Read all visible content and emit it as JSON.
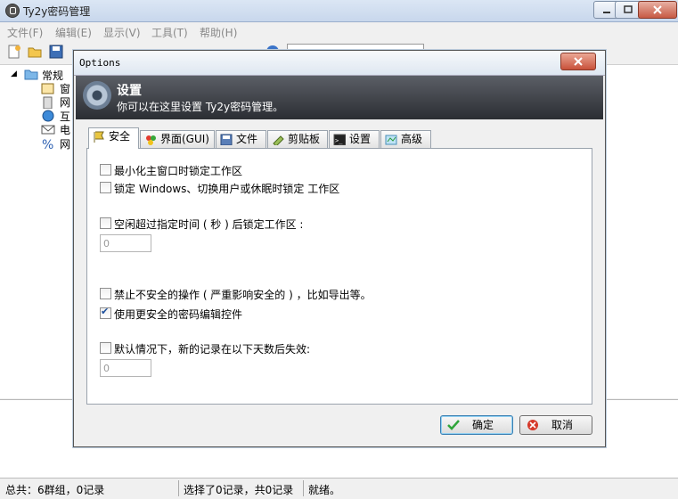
{
  "window": {
    "title": "Ty2y密码管理",
    "min": "0",
    "max": "1",
    "close": "r"
  },
  "menu": [
    "文件(F)",
    "编辑(E)",
    "显示(V)",
    "工具(T)",
    "帮助(H)"
  ],
  "tree": {
    "root": "常规",
    "items": [
      "窗",
      "网",
      "互",
      "电",
      "网"
    ]
  },
  "status": {
    "left": "总共：6群组，0记录",
    "middle": "选择了0记录，共0记录",
    "right": "就绪。"
  },
  "dialog": {
    "title": "Options",
    "close": "x",
    "header_title": "设置",
    "header_subtitle": "你可以在这里设置 Ty2y密码管理。",
    "tabs": [
      "安全",
      "界面(GUI)",
      "文件",
      "剪贴板",
      "设置",
      "高级"
    ],
    "options": [
      {
        "label": "最小化主窗口时锁定工作区",
        "checked": false
      },
      {
        "label": "锁定 Windows、切换用户或休眠时锁定 工作区",
        "checked": false
      },
      {
        "label": "空闲超过指定时间 ( 秒 ) 后锁定工作区 :",
        "checked": false
      },
      {
        "label": "禁止不安全的操作 ( 严重影响安全的 ) ，比如导出等。",
        "checked": false
      },
      {
        "label": "使用更安全的密码编辑控件",
        "checked": true
      },
      {
        "label": "默认情况下，新的记录在以下天数后失效:",
        "checked": false
      }
    ],
    "idle_value": "0",
    "expire_value": "0",
    "ok": "确定",
    "cancel": "取消"
  }
}
